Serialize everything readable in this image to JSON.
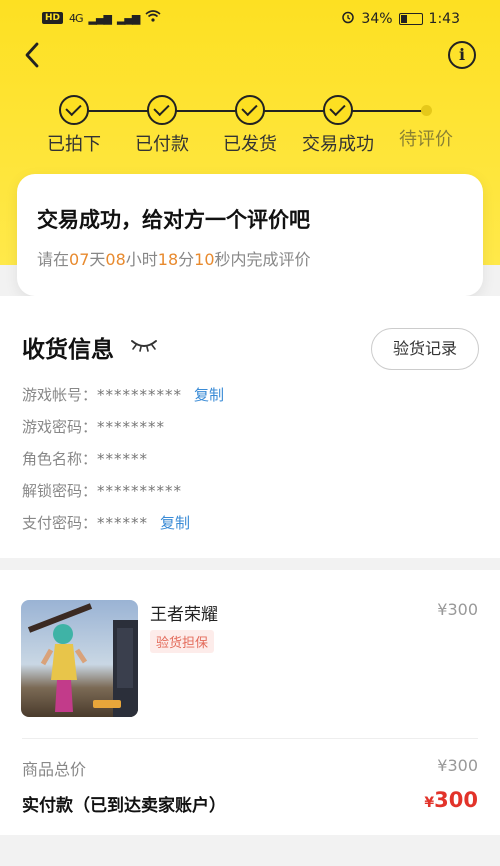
{
  "status_bar": {
    "hd": "HD",
    "network": "4G",
    "battery": "34%",
    "battery_fraction": 0.34,
    "time": "1:43"
  },
  "accent": "#fde022",
  "steps": [
    {
      "label": "已拍下",
      "done": true
    },
    {
      "label": "已付款",
      "done": true
    },
    {
      "label": "已发货",
      "done": true
    },
    {
      "label": "交易成功",
      "done": true
    },
    {
      "label": "待评价",
      "done": false
    }
  ],
  "status_card": {
    "title": "交易成功，给对方一个评价吧",
    "prefix": "请在",
    "days": "07",
    "days_unit": "天",
    "hours": "08",
    "hours_unit": "小时",
    "minutes": "18",
    "minutes_unit": "分",
    "seconds": "10",
    "seconds_unit": "秒内完成评价"
  },
  "receive_info": {
    "title": "收货信息",
    "inspect_button": "验货记录",
    "rows": [
      {
        "label": "游戏帐号：",
        "value": "**********",
        "copy": "复制"
      },
      {
        "label": "游戏密码：",
        "value": "********"
      },
      {
        "label": "角色名称：",
        "value": "******"
      },
      {
        "label": "解锁密码：",
        "value": "**********"
      },
      {
        "label": "支付密码：",
        "value": "******",
        "copy": "复制"
      }
    ]
  },
  "order": {
    "game_name": "王者荣耀",
    "badge": "验货担保",
    "price": "¥300",
    "total_label": "商品总价",
    "total_value": "¥300",
    "paid_label": "实付款（已到达卖家账户）",
    "paid_currency": "¥",
    "paid_value": "300"
  }
}
